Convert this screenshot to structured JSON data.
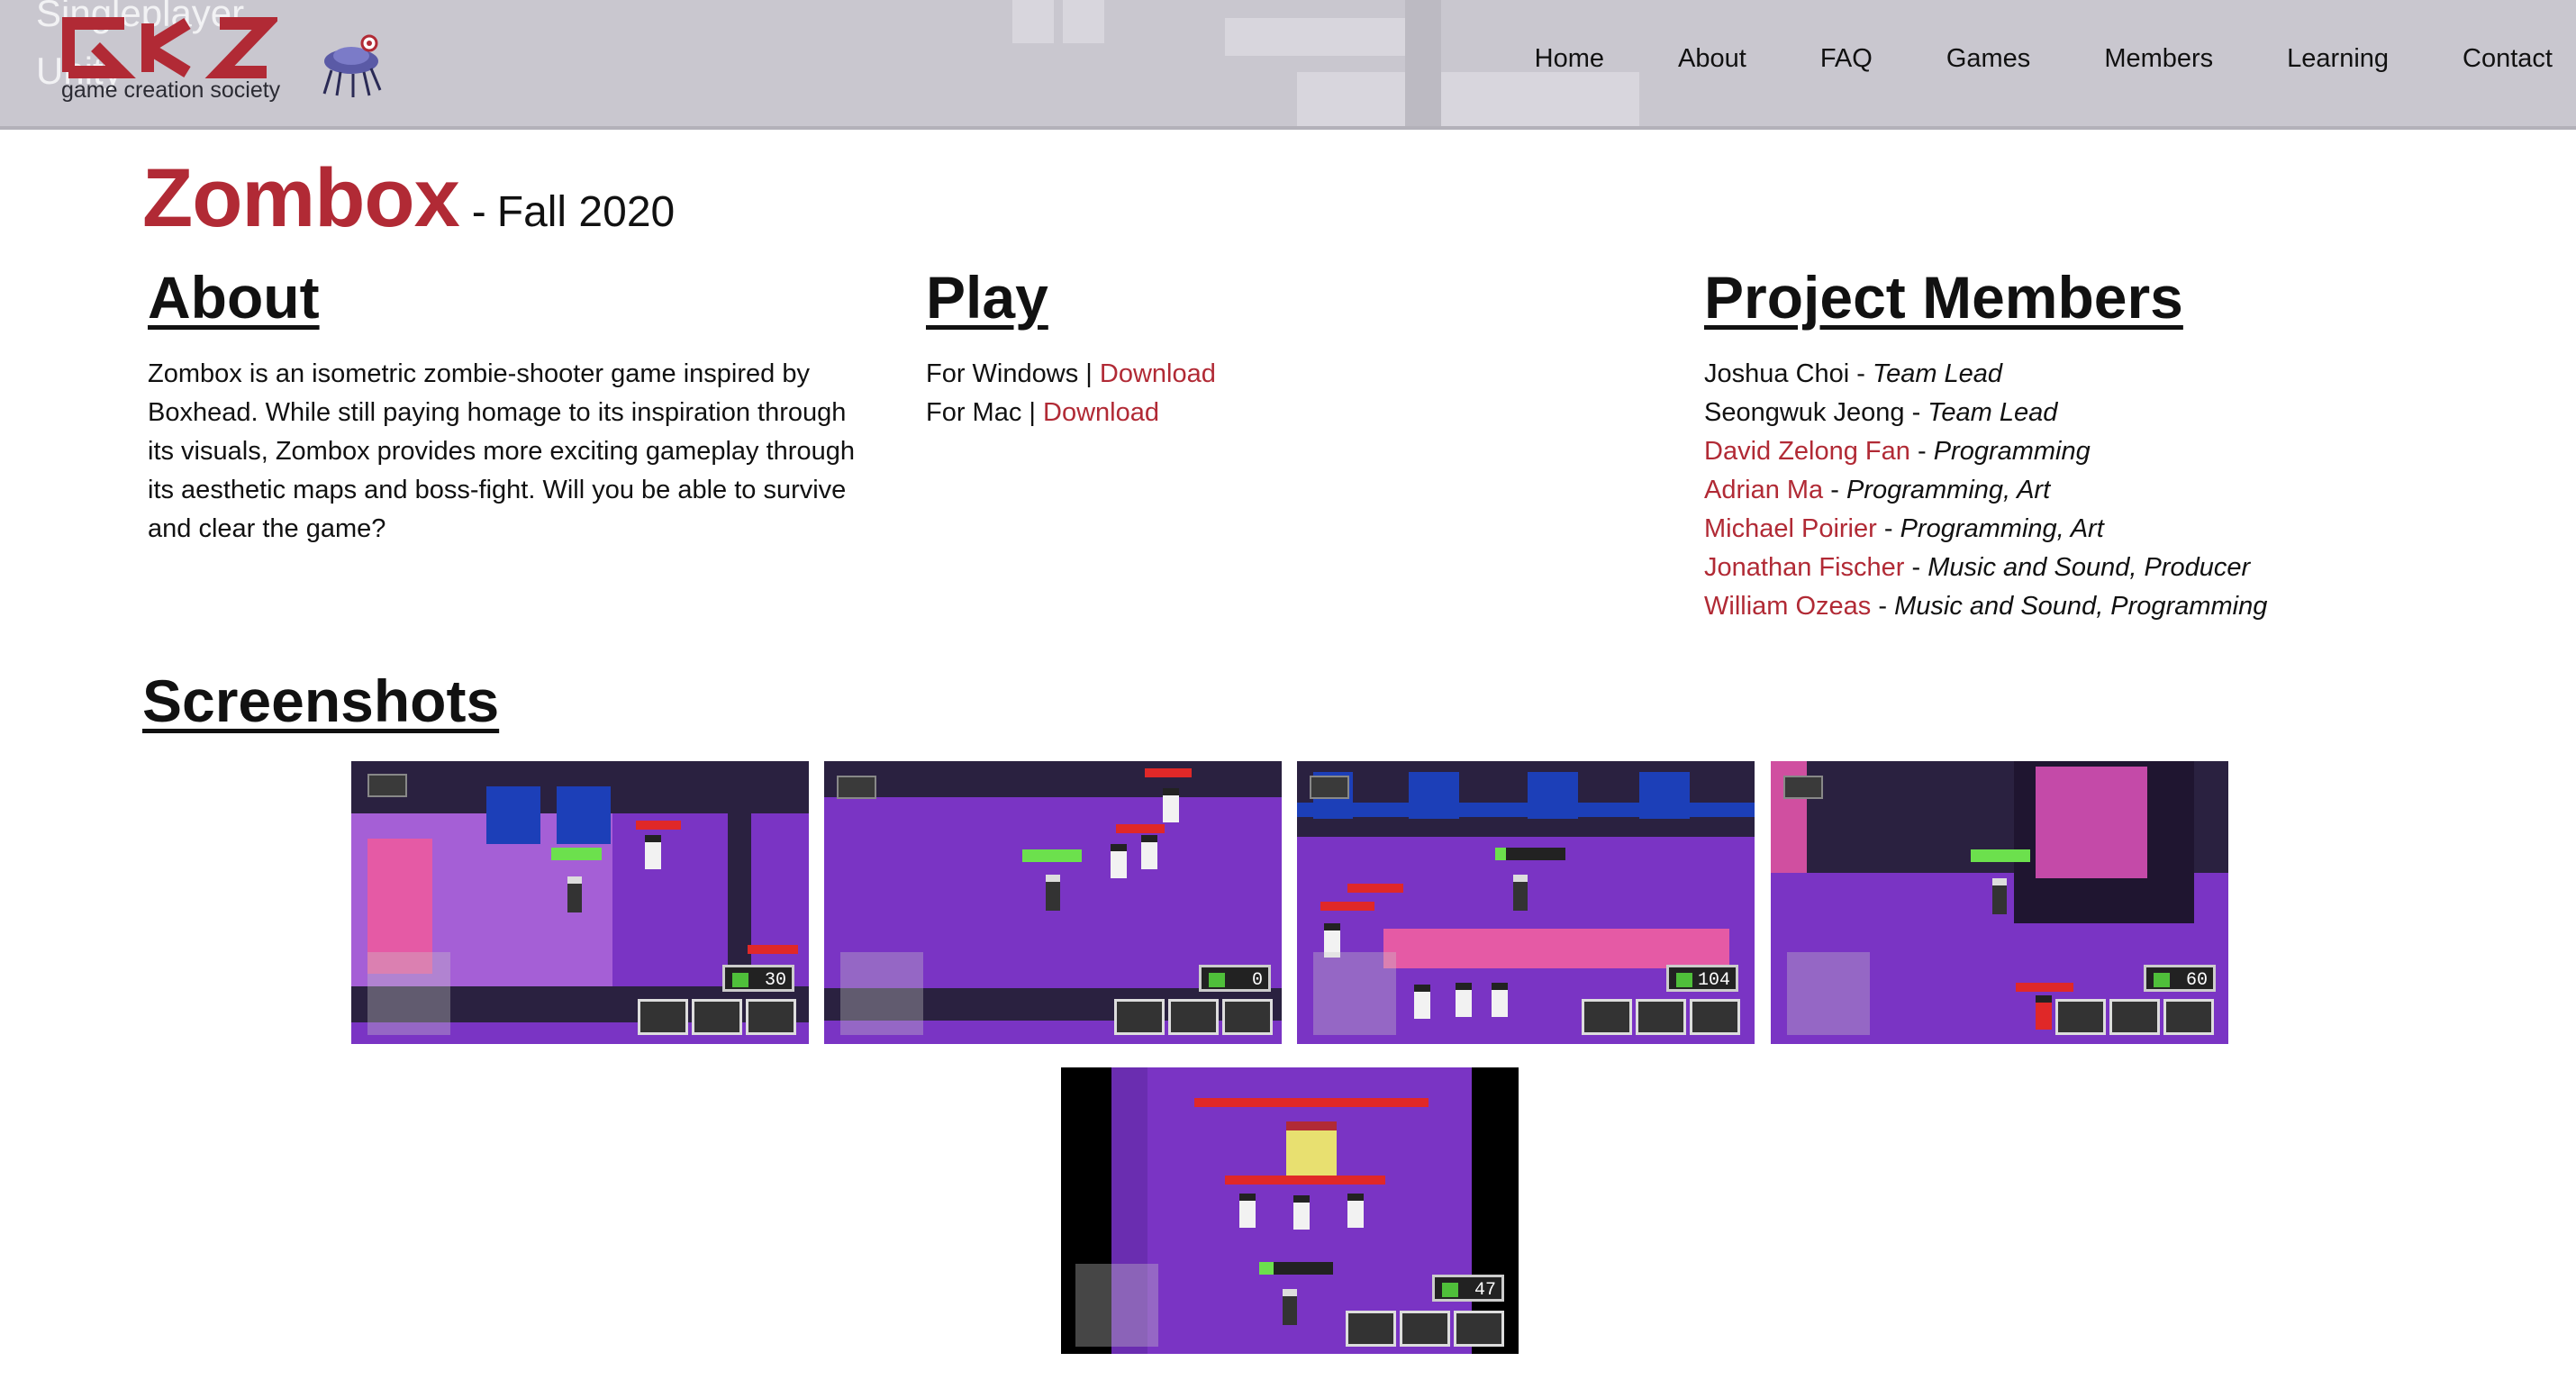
{
  "header": {
    "ghost_line1": "Singleplayer",
    "ghost_line2": "Unity",
    "logo_caption": "game creation society",
    "nav": [
      "Home",
      "About",
      "FAQ",
      "Games",
      "Members",
      "Learning",
      "Contact"
    ]
  },
  "game": {
    "title": "Zombox",
    "separator": "-",
    "semester": "Fall 2020"
  },
  "about": {
    "heading": "About",
    "lines": [
      "Zombox is an isometric zombie-shooter game inspired by",
      "Boxhead. While still paying homage to its inspiration through",
      "its visuals, Zombox provides more exciting gameplay through",
      "its aesthetic maps and boss-fight. Will you be able to survive",
      "and clear the game?"
    ]
  },
  "play": {
    "heading": "Play",
    "items": [
      {
        "platform": "For Windows",
        "sep": "|",
        "link": "Download"
      },
      {
        "platform": "For Mac",
        "sep": "|",
        "link": "Download"
      }
    ]
  },
  "members": {
    "heading": "Project Members",
    "list": [
      {
        "name": "Joshua Choi",
        "sep": "-",
        "role": "Team Lead"
      },
      {
        "name": "Seongwuk Jeong",
        "sep": "-",
        "role": "Team Lead"
      },
      {
        "name": "David Zelong Fan",
        "sep": "-",
        "role": "Programming"
      },
      {
        "name": "Adrian Ma",
        "sep": "-",
        "role": "Programming, Art"
      },
      {
        "name": "Michael Poirier",
        "sep": "-",
        "role": "Programming, Art"
      },
      {
        "name": "Jonathan Fischer",
        "sep": "-",
        "role": "Music and Sound, Producer"
      },
      {
        "name": "William Ozeas",
        "sep": "-",
        "role": "Music and Sound, Programming"
      }
    ]
  },
  "screenshots": {
    "heading": "Screenshots",
    "money": [
      "30",
      "0",
      "104",
      "60",
      "47"
    ]
  },
  "colors": {
    "accent": "#b12a35",
    "game_purple": "#7a34c4",
    "header_bg": "#c9c7cf"
  },
  "icons": [
    "gcs-logo",
    "mascot-icon"
  ]
}
